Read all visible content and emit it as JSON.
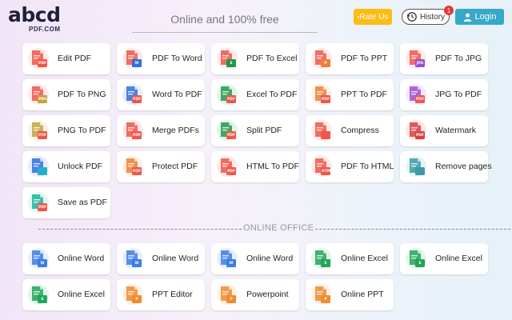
{
  "header": {
    "logo_main": "abcd",
    "logo_sub": "PDF.COM",
    "tagline": "Online and 100% free",
    "rate_label": "Rate Us",
    "history_label": "History",
    "history_count": "1",
    "login_label": "Login"
  },
  "office_section_title": "ONLINE OFFICE",
  "tools": [
    {
      "label": "Edit PDF",
      "icon": "edit-pdf-icon",
      "color": "#f0564a",
      "tag": "PDF"
    },
    {
      "label": "PDF To Word",
      "icon": "pdf-to-word-icon",
      "color": "#f0564a",
      "accent": "#2f6fe0",
      "tag": "W"
    },
    {
      "label": "PDF To Excel",
      "icon": "pdf-to-excel-icon",
      "color": "#f0564a",
      "accent": "#1f9a4b",
      "tag": "E"
    },
    {
      "label": "PDF To PPT",
      "icon": "pdf-to-ppt-icon",
      "color": "#f0564a",
      "accent": "#f08030",
      "tag": "P"
    },
    {
      "label": "PDF To JPG",
      "icon": "pdf-to-jpg-icon",
      "color": "#f0564a",
      "accent": "#9b4fd4",
      "tag": "JPG"
    },
    {
      "label": "PDF To PNG",
      "icon": "pdf-to-png-icon",
      "color": "#f0564a",
      "accent": "#c8a042",
      "tag": "PNG"
    },
    {
      "label": "Word To PDF",
      "icon": "word-to-pdf-icon",
      "color": "#2f6fe0",
      "accent": "#f0564a",
      "tag": "PDF"
    },
    {
      "label": "Excel To PDF",
      "icon": "excel-to-pdf-icon",
      "color": "#1f9a4b",
      "accent": "#f0564a",
      "tag": "PDF"
    },
    {
      "label": "PPT To PDF",
      "icon": "ppt-to-pdf-icon",
      "color": "#f08030",
      "accent": "#f0564a",
      "tag": "PDF"
    },
    {
      "label": "JPG To PDF",
      "icon": "jpg-to-pdf-icon",
      "color": "#9b4fd4",
      "accent": "#f0564a",
      "tag": "PDF"
    },
    {
      "label": "PNG To PDF",
      "icon": "png-to-pdf-icon",
      "color": "#c8a042",
      "accent": "#f0564a",
      "tag": "PDF"
    },
    {
      "label": "Merge PDFs",
      "icon": "merge-pdfs-icon",
      "color": "#f0564a",
      "tag": "PDF"
    },
    {
      "label": "Split PDF",
      "icon": "split-pdf-icon",
      "color": "#1f9a4b",
      "accent": "#f0564a",
      "tag": "PDF"
    },
    {
      "label": "Compress",
      "icon": "compress-icon",
      "color": "#f0564a",
      "tag": ""
    },
    {
      "label": "Watermark",
      "icon": "watermark-icon",
      "color": "#d94040",
      "tag": "PDF"
    },
    {
      "label": "Unlock PDF",
      "icon": "unlock-pdf-icon",
      "color": "#2f6fe0",
      "accent": "#23b0c8",
      "tag": ""
    },
    {
      "label": "Protect PDF",
      "icon": "protect-pdf-icon",
      "color": "#f08030",
      "accent": "#f0564a",
      "tag": "PDF"
    },
    {
      "label": "HTML To PDF",
      "icon": "html-to-pdf-icon",
      "color": "#f0564a",
      "accent": "#f0564a",
      "tag": "PDF"
    },
    {
      "label": "PDF To HTML",
      "icon": "pdf-to-html-icon",
      "color": "#f0564a",
      "accent": "#f0564a",
      "tag": "HTML"
    },
    {
      "label": "Remove pages",
      "icon": "remove-pages-icon",
      "color": "#3a9aa6",
      "tag": ""
    },
    {
      "label": "Save as PDF",
      "icon": "save-as-pdf-icon",
      "color": "#1fb59a",
      "accent": "#f0564a",
      "tag": "PDF"
    }
  ],
  "office": [
    {
      "label": "Online Word",
      "icon": "online-word-icon",
      "color": "#3d7de8",
      "tag": "W"
    },
    {
      "label": "Online Word",
      "icon": "online-word-add-icon",
      "color": "#3d7de8",
      "tag": "W"
    },
    {
      "label": "Online Word",
      "icon": "online-word-edit-icon",
      "color": "#3d7de8",
      "tag": "W"
    },
    {
      "label": "Online Excel",
      "icon": "online-excel-edit-icon",
      "color": "#21a659",
      "tag": "E"
    },
    {
      "label": "Online Excel",
      "icon": "online-excel-add-icon",
      "color": "#21a659",
      "tag": "E"
    },
    {
      "label": "Online Excel",
      "icon": "online-excel-icon",
      "color": "#21a659",
      "tag": "E"
    },
    {
      "label": "PPT Editor",
      "icon": "ppt-editor-icon",
      "color": "#f28a2e",
      "tag": "P"
    },
    {
      "label": "Powerpoint",
      "icon": "powerpoint-icon",
      "color": "#f28a2e",
      "tag": "P"
    },
    {
      "label": "Online PPT",
      "icon": "online-ppt-icon",
      "color": "#f28a2e",
      "tag": "P"
    }
  ]
}
